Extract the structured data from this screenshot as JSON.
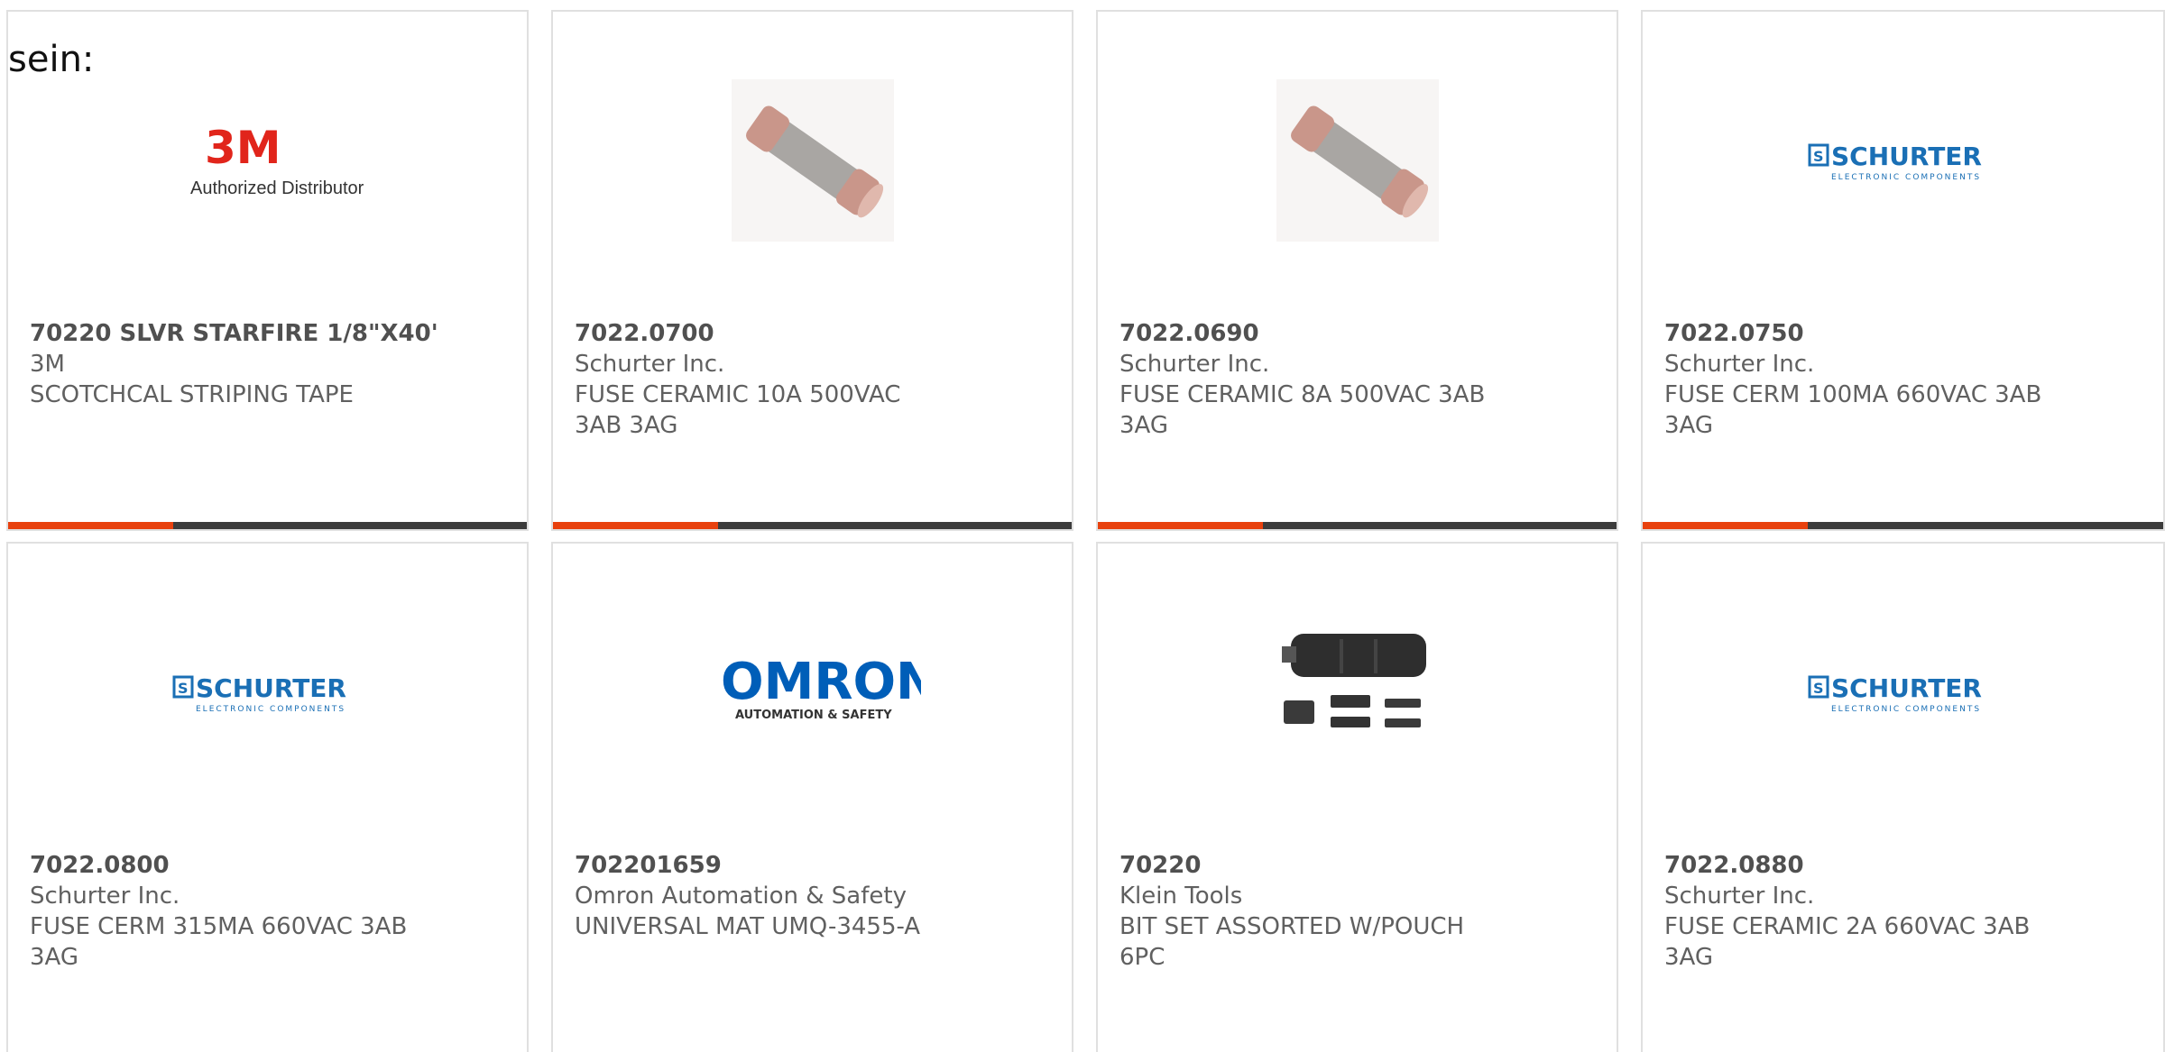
{
  "header_fragment": "sein:",
  "products": [
    {
      "part": "70220 SLVR STARFIRE 1/8\"X40'",
      "manufacturer": "3M",
      "description": "SCOTCHCAL STRIPING TAPE",
      "image": "3m-logo-icon",
      "logo_text": "3M",
      "logo_sub": "Authorized Distributor"
    },
    {
      "part": "7022.0700",
      "manufacturer": "Schurter Inc.",
      "description": "FUSE CERAMIC 10A 500VAC 3AB 3AG",
      "image": "fuse-icon"
    },
    {
      "part": "7022.0690",
      "manufacturer": "Schurter Inc.",
      "description": "FUSE CERAMIC 8A 500VAC 3AB 3AG",
      "image": "fuse-icon"
    },
    {
      "part": "7022.0750",
      "manufacturer": "Schurter Inc.",
      "description": "FUSE CERM 100MA 660VAC 3AB 3AG",
      "image": "schurter-logo-icon",
      "logo_text": "SCHURTER",
      "logo_sub": "ELECTRONIC COMPONENTS"
    },
    {
      "part": "7022.0800",
      "manufacturer": "Schurter Inc.",
      "description": "FUSE CERM 315MA 660VAC 3AB 3AG",
      "image": "schurter-logo-icon",
      "logo_text": "SCHURTER",
      "logo_sub": "ELECTRONIC COMPONENTS"
    },
    {
      "part": "702201659",
      "manufacturer": "Omron Automation & Safety",
      "description": "UNIVERSAL MAT UMQ-3455-A",
      "image": "omron-logo-icon",
      "logo_text": "OMRON",
      "logo_sub": "AUTOMATION & SAFETY"
    },
    {
      "part": "70220",
      "manufacturer": "Klein Tools",
      "description": "BIT SET ASSORTED W/POUCH 6PC",
      "image": "bit-set-icon"
    },
    {
      "part": "7022.0880",
      "manufacturer": "Schurter Inc.",
      "description": "FUSE CERAMIC 2A 660VAC 3AB 3AG",
      "image": "schurter-logo-icon",
      "logo_text": "SCHURTER",
      "logo_sub": "ELECTRONIC COMPONENTS"
    }
  ],
  "colors": {
    "accent": "#e8410e",
    "bar": "#3c3c3c",
    "schurter_blue": "#1a6fb5",
    "omron_blue": "#005eb8",
    "threem_red": "#e1251b"
  }
}
